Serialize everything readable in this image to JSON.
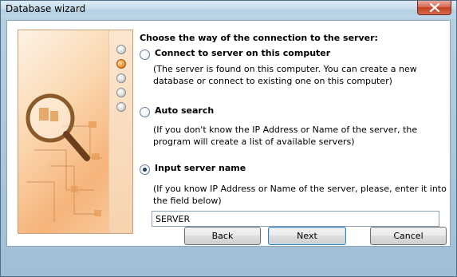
{
  "window": {
    "title": "Database wizard"
  },
  "heading": "Choose the way of the connection to the server:",
  "options": [
    {
      "label": "Connect to server on this computer",
      "description": "(The server is found on this computer. You can create a new database or connect to existing one on this computer)",
      "checked": false
    },
    {
      "label": "Auto search",
      "description": "(If you don't know the IP Address or Name of the server, the program will create a list of available servers)",
      "checked": false
    },
    {
      "label": "Input server name",
      "description": "(If you know IP Address or Name of the server, please, enter it into the field below)",
      "checked": true
    }
  ],
  "server_input": {
    "value": "SERVER"
  },
  "buttons": {
    "back": "Back",
    "next": "Next",
    "cancel": "Cancel"
  },
  "steps": {
    "total": 5,
    "current": 2
  },
  "colors": {
    "accent_orange": "#f39a3a",
    "title_bar": "#c4dbe9",
    "close_red": "#c2401f"
  }
}
